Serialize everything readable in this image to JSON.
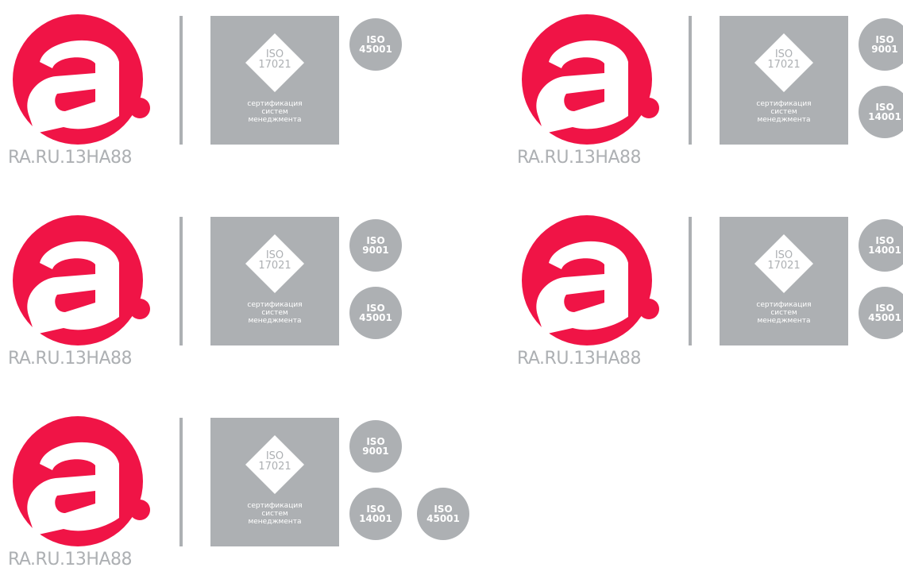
{
  "colors": {
    "brand_red": "#f01446",
    "gray": "#adb0b3",
    "white": "#ffffff"
  },
  "icons": {
    "logo": "accreditation-a-icon",
    "diamond": "diamond-icon"
  },
  "groups": [
    {
      "reg_code": "RA.RU.13HA88",
      "cert": {
        "line1": "ISO",
        "line2": "17021",
        "caption1": "сертификация",
        "caption2": "систем",
        "caption3": "менеджмента"
      },
      "badges": [
        {
          "line1": "ISO",
          "line2": "45001"
        }
      ]
    },
    {
      "reg_code": "RA.RU.13HA88",
      "cert": {
        "line1": "ISO",
        "line2": "17021",
        "caption1": "сертификация",
        "caption2": "систем",
        "caption3": "менеджмента"
      },
      "badges": [
        {
          "line1": "ISO",
          "line2": "9001"
        },
        {
          "line1": "ISO",
          "line2": "14001"
        }
      ]
    },
    {
      "reg_code": "RA.RU.13HA88",
      "cert": {
        "line1": "ISO",
        "line2": "17021",
        "caption1": "сертификация",
        "caption2": "систем",
        "caption3": "менеджмента"
      },
      "badges": [
        {
          "line1": "ISO",
          "line2": "9001"
        },
        {
          "line1": "ISO",
          "line2": "45001"
        }
      ]
    },
    {
      "reg_code": "RA.RU.13HA88",
      "cert": {
        "line1": "ISO",
        "line2": "17021",
        "caption1": "сертификация",
        "caption2": "систем",
        "caption3": "менеджмента"
      },
      "badges": [
        {
          "line1": "ISO",
          "line2": "14001"
        },
        {
          "line1": "ISO",
          "line2": "45001"
        }
      ]
    },
    {
      "reg_code": "RA.RU.13HA88",
      "cert": {
        "line1": "ISO",
        "line2": "17021",
        "caption1": "сертификация",
        "caption2": "систем",
        "caption3": "менеджмента"
      },
      "badges": [
        {
          "line1": "ISO",
          "line2": "9001"
        },
        {
          "line1": "ISO",
          "line2": "14001"
        },
        {
          "line1": "ISO",
          "line2": "45001"
        }
      ]
    }
  ]
}
